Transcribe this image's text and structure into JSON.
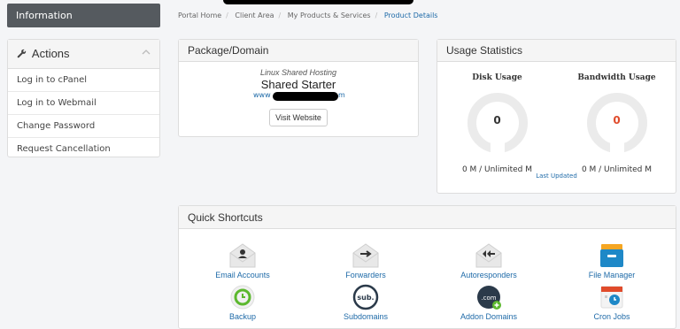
{
  "sidebar": {
    "information_label": "Information",
    "actions_title": "Actions",
    "actions": [
      "Log in to cPanel",
      "Log in to Webmail",
      "Change Password",
      "Request Cancellation"
    ]
  },
  "breadcrumb": [
    "Portal Home",
    "Client Area",
    "My Products & Services",
    "Product Details"
  ],
  "package": {
    "title": "Package/Domain",
    "group": "Linux Shared Hosting",
    "name": "Shared Starter",
    "domain_prefix": "www",
    "domain_suffix": "m",
    "visit_label": "Visit Website"
  },
  "usage": {
    "title": "Usage Statistics",
    "disk": {
      "label": "Disk Usage",
      "value": "0",
      "amount": "0 M / Unlimited M",
      "color": "#333333"
    },
    "bandwidth": {
      "label": "Bandwidth Usage",
      "value": "0",
      "amount": "0 M / Unlimited M",
      "color": "#e04b2b"
    },
    "last_updated": "Last Updated"
  },
  "quick": {
    "title": "Quick Shortcuts",
    "items": [
      {
        "label": "Email Accounts",
        "icon": "email-accounts-icon"
      },
      {
        "label": "Forwarders",
        "icon": "forwarders-icon"
      },
      {
        "label": "Autoresponders",
        "icon": "autoresponders-icon"
      },
      {
        "label": "File Manager",
        "icon": "file-manager-icon"
      },
      {
        "label": "Backup",
        "icon": "backup-icon"
      },
      {
        "label": "Subdomains",
        "icon": "subdomains-icon"
      },
      {
        "label": "Addon Domains",
        "icon": "addon-domains-icon"
      },
      {
        "label": "Cron Jobs",
        "icon": "cron-jobs-icon"
      }
    ],
    "addon_icon_text": ".com",
    "subdomain_icon_text": "sub."
  }
}
